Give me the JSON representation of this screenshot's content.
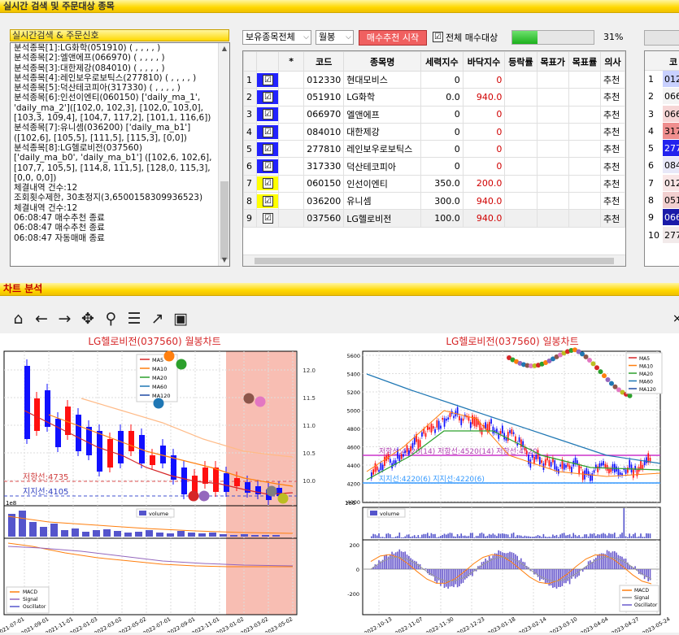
{
  "top_section": {
    "title": "실시간 검색 및 주문대상 종목"
  },
  "log_panel": {
    "title": "실시간검색 & 주문신호",
    "lines": [
      "분석종목[1]:LG화학(051910) ( , , , , )",
      "분석종목[2]:엘앤에프(066970) ( , , , , )",
      "분석종목[3]:대한제강(084010) ( , , , , )",
      "분석종목[4]:레인보우로보틱스(277810) ( , , , , )",
      "분석종목[5]:덕산테코피아(317330) ( , , , , )",
      "분석종목[6]:인선이엔티(060150) ['daily_ma_1',",
      "'daily_ma_2']([102,0, 102,3], [102,0, 103,0],",
      "[103,3, 109,4], [104,7, 117,2], [101,1, 116,6])",
      "분석종목[7]:유니셈(036200) ['daily_ma_b1']",
      "([102,6], [105,5], [111,5], [115,3], [0,0])",
      "분석종목[8]:LG헬로비전(037560)",
      "['daily_ma_b0', 'daily_ma_b1'] ([102,6, 102,6],",
      "[107,7, 105,5], [114,8, 111,5], [128,0, 115,3],",
      "[0,0, 0,0])",
      "체결내역 건수:12",
      "조회횟수제한, 30초정지(3,6500158309936523)",
      "체결내역 건수:12",
      "06:08:47 매수추천 종료",
      "06:08:47 매수추천 종료",
      "06:08:47 자동매매 종료"
    ]
  },
  "controls": {
    "holding_select": "보유종목전체",
    "period_select": "월봉",
    "start_button": "매수추천 시작",
    "buy_all_label": "전체 매수대상",
    "buy_all_checked": "☑",
    "progress_percent": 31,
    "progress_text": "31%"
  },
  "grid": {
    "columns": [
      "",
      "",
      "*",
      "코드",
      "종목명",
      "세력지수",
      "바닥지수",
      "등락률",
      "목표가",
      "목표률",
      "의사"
    ],
    "rows": [
      {
        "no": "1",
        "check": "☑",
        "code": "012330",
        "name": "현대모비스",
        "power": "0",
        "bottom": "0",
        "advice": "추천"
      },
      {
        "no": "2",
        "check": "☑",
        "code": "051910",
        "name": "LG화학",
        "power": "0.0",
        "bottom": "940.0",
        "advice": "추천"
      },
      {
        "no": "3",
        "check": "☑",
        "code": "066970",
        "name": "엘앤에프",
        "power": "0",
        "bottom": "0",
        "advice": "추천"
      },
      {
        "no": "4",
        "check": "☑",
        "code": "084010",
        "name": "대한제강",
        "power": "0",
        "bottom": "0",
        "advice": "추천"
      },
      {
        "no": "5",
        "check": "☑",
        "code": "277810",
        "name": "레인보우로보틱스",
        "power": "0",
        "bottom": "0",
        "advice": "추천"
      },
      {
        "no": "6",
        "check": "☑",
        "code": "317330",
        "name": "덕산테코피아",
        "power": "0",
        "bottom": "0",
        "advice": "추천"
      },
      {
        "no": "7",
        "check": "☑",
        "code": "060150",
        "name": "인선이엔티",
        "power": "350.0",
        "bottom": "200.0",
        "advice": "추천"
      },
      {
        "no": "8",
        "check": "☑",
        "code": "036200",
        "name": "유니셈",
        "power": "300.0",
        "bottom": "940.0",
        "advice": "추천"
      },
      {
        "no": "9",
        "check": "☑",
        "code": "037560",
        "name": "LG헬로비전",
        "power": "100.0",
        "bottom": "940.0",
        "advice": "추천"
      }
    ],
    "row_colors": [
      "#2222ff",
      "#2222ff",
      "#2222ff",
      "#2222ff",
      "#2222ff",
      "#2222ff",
      "#ffff00",
      "#ffff00",
      "none"
    ]
  },
  "grid2": {
    "header": "코",
    "rows": [
      {
        "no": "1",
        "code": "012",
        "color": "#c8d0ff"
      },
      {
        "no": "2",
        "code": "066",
        "color": "#f4f4f4"
      },
      {
        "no": "3",
        "code": "066",
        "color": "#f6d6d6"
      },
      {
        "no": "4",
        "code": "317",
        "color": "#ef8e8e"
      },
      {
        "no": "5",
        "code": "277",
        "color": "#2222ee"
      },
      {
        "no": "6",
        "code": "084",
        "color": "#e8e8f8"
      },
      {
        "no": "7",
        "code": "012",
        "color": "#f9e6e6"
      },
      {
        "no": "8",
        "code": "051",
        "color": "#f2cfcf"
      },
      {
        "no": "9",
        "code": "066",
        "color": "#1a1aa8"
      },
      {
        "no": "10",
        "code": "277",
        "color": "#f2eaea"
      }
    ]
  },
  "chart_section": {
    "title": "차트 분석"
  },
  "toolbar": {
    "icons": [
      "home-icon",
      "back-arrow-icon",
      "forward-arrow-icon",
      "pan-icon",
      "zoom-icon",
      "configure-subplots-icon",
      "edit-axis-icon",
      "save-icon"
    ],
    "close": "×"
  },
  "chart_data": [
    {
      "type": "candlestick",
      "title": "LG헬로비전(037560) 월봉차트",
      "legend": [
        "MA5",
        "MA10",
        "MA20",
        "MA60",
        "MA120"
      ],
      "legend_colors": [
        "#d62728",
        "#ff7f0e",
        "#2ca02c",
        "#1f77b4",
        "#1f4ba4"
      ],
      "y_ticks": [
        12.0,
        11.5,
        11.0,
        10.5,
        10.0
      ],
      "y_scale_label": "1e3",
      "resistance_label": "저항선:4735",
      "support_label": "지지선:4105",
      "volume_legend": "volume",
      "volume_scale_label": "1e8",
      "macd_legend": [
        "MACD",
        "Signal",
        "Oscillator"
      ],
      "x_ticks": [
        "2021-07-01",
        "2021-09-01",
        "2021-11-01",
        "2022-01-03",
        "2022-03-02",
        "2022-05-02",
        "2022-07-01",
        "2022-09-01",
        "2022-11-01",
        "2023-01-02",
        "2023-03-02",
        "2023-05-02"
      ],
      "highlight_range": [
        "2023-01-02",
        "2023-05-02"
      ],
      "legend_position": "top-center"
    },
    {
      "type": "candlestick",
      "title": "LG헬로비전(037560) 일봉차트",
      "legend": [
        "MA5",
        "MA10",
        "MA20",
        "MA60",
        "MA120"
      ],
      "legend_colors": [
        "#d62728",
        "#ff7f0e",
        "#2ca02c",
        "#1f77b4",
        "#1f4ba4"
      ],
      "y_ticks": [
        5600,
        5400,
        5200,
        5000,
        4800,
        4600,
        4400,
        4200,
        4000
      ],
      "volume_scale_label": "1e6",
      "volume_legend": "volume",
      "resistance_label": "저항선:4520(14) 저항선:4520(14) 저항선:4520",
      "support_label": "지지선:4220(6)  지지선:4220(6)",
      "macd_y_ticks": [
        200,
        0,
        -200
      ],
      "macd_legend": [
        "MACD",
        "Signal",
        "Oscillator"
      ],
      "x_ticks": [
        "2022-10-13",
        "2022-11-07",
        "2022-11-30",
        "2022-12-23",
        "2023-01-18",
        "2023-02-14",
        "2023-03-10",
        "2023-04-04",
        "2023-04-27",
        "2023-05-24"
      ],
      "legend_position": "top-right"
    }
  ]
}
